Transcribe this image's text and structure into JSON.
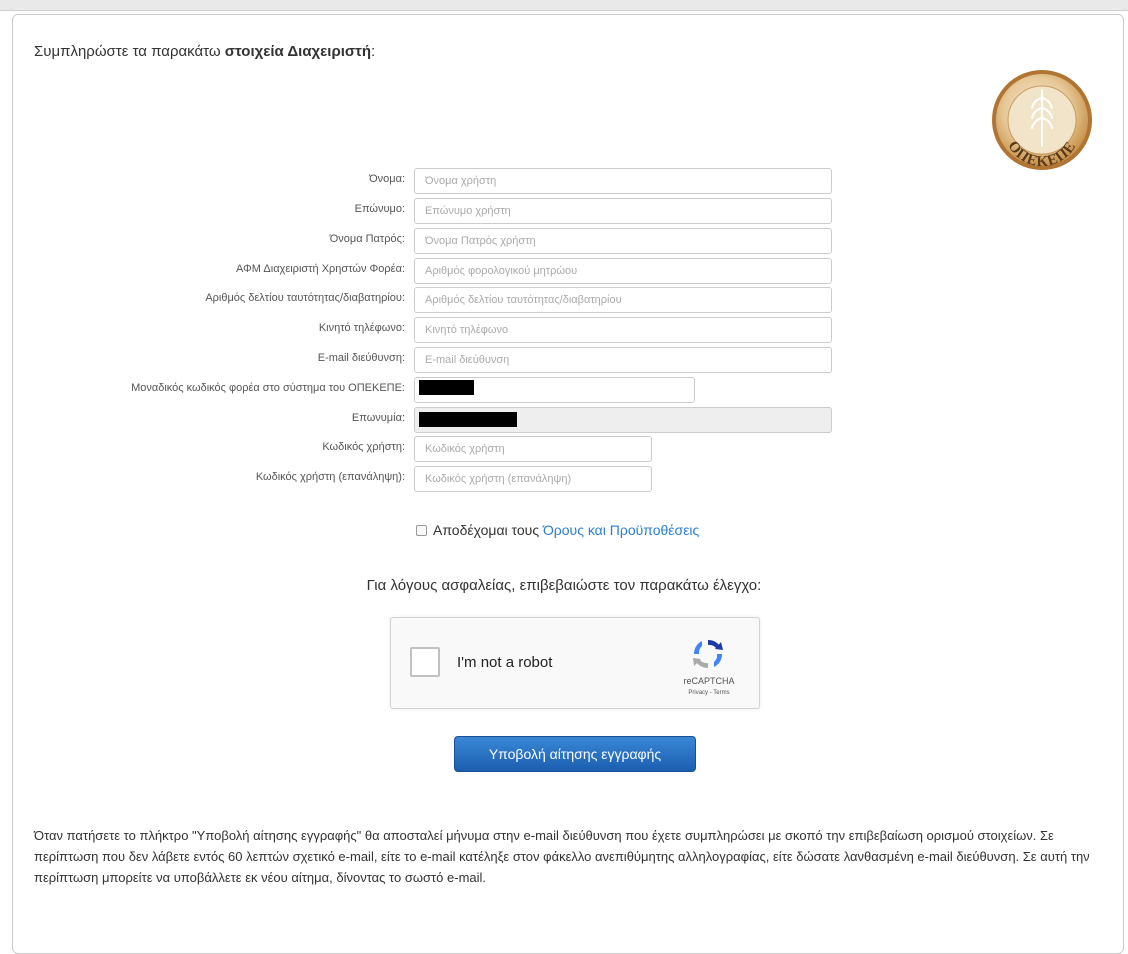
{
  "intro": {
    "prefix": "Συμπληρώστε τα παρακάτω ",
    "bold": "στοιχεία Διαχειριστή",
    "suffix": ":"
  },
  "logo": {
    "text": "ΟΠΕΚΕΠΕ",
    "icon": "wheat-coin-logo"
  },
  "form": {
    "fields": [
      {
        "label": "Όνομα:",
        "placeholder": "Όνομα χρήστη",
        "value": ""
      },
      {
        "label": "Επώνυμο:",
        "placeholder": "Επώνυμο χρήστη",
        "value": ""
      },
      {
        "label": "Όνομα Πατρός:",
        "placeholder": "Όνομα Πατρός χρήστη",
        "value": ""
      },
      {
        "label": "ΑΦΜ Διαχειριστή Χρηστών Φορέα:",
        "placeholder": "Αριθμός φορολογικού μητρώου",
        "value": ""
      },
      {
        "label": "Αριθμός δελτίου ταυτότητας/διαβατηρίου:",
        "placeholder": "Αριθμός δελτίου ταυτότητας/διαβατηρίου",
        "value": ""
      },
      {
        "label": "Κινητό τηλέφωνο:",
        "placeholder": "Κινητό τηλέφωνο",
        "value": ""
      },
      {
        "label": "E-mail διεύθυνση:",
        "placeholder": "E-mail διεύθυνση",
        "value": ""
      },
      {
        "label": "Μοναδικός κωδικός φορέα στο σύστημα του ΟΠΕΚΕΠΕ:",
        "placeholder": "",
        "value": ""
      },
      {
        "label": "Επωνυμία:",
        "placeholder": "",
        "value": ""
      },
      {
        "label": "Κωδικός χρήστη:",
        "placeholder": "Κωδικός χρήστη",
        "value": ""
      },
      {
        "label": "Κωδικός χρήστη (επανάληψη):",
        "placeholder": "Κωδικός χρήστη (επανάληψη)",
        "value": ""
      }
    ]
  },
  "terms": {
    "prefix": "Αποδέχομαι τους ",
    "link": "Όρους και Προϋποθέσεις",
    "checked": false
  },
  "security_note": "Για λόγους ασφαλείας, επιβεβαιώστε τον παρακάτω έλεγχο:",
  "captcha": {
    "label": "I'm not a robot",
    "brand": "reCAPTCHA",
    "links": "Privacy - Terms",
    "checked": false
  },
  "submit_label": "Υποβολή αίτησης εγγραφής",
  "footer_note": "Όταν πατήσετε το πλήκτρο \"Υποβολή αίτησης εγγραφής\" θα αποσταλεί μήνυμα στην e-mail διεύθυνση που έχετε συμπληρώσει με σκοπό την επιβεβαίωση ορισμού στοιχείων. Σε περίπτωση που δεν λάβετε εντός 60 λεπτών σχετικό e-mail, είτε το e-mail κατέληξε στον φάκελλο ανεπιθύμητης αλληλογραφίας, είτε δώσατε λανθασμένη e-mail διεύθυνση. Σε αυτή την περίπτωση μπορείτε να υποβάλλετε εκ νέου αίτημα, δίνοντας το σωστό e-mail.",
  "colors": {
    "link": "#2a7fd0",
    "button": "#1b5eb0",
    "readonly_bg": "#eeeeee",
    "logo_gold": "#c8924a"
  }
}
